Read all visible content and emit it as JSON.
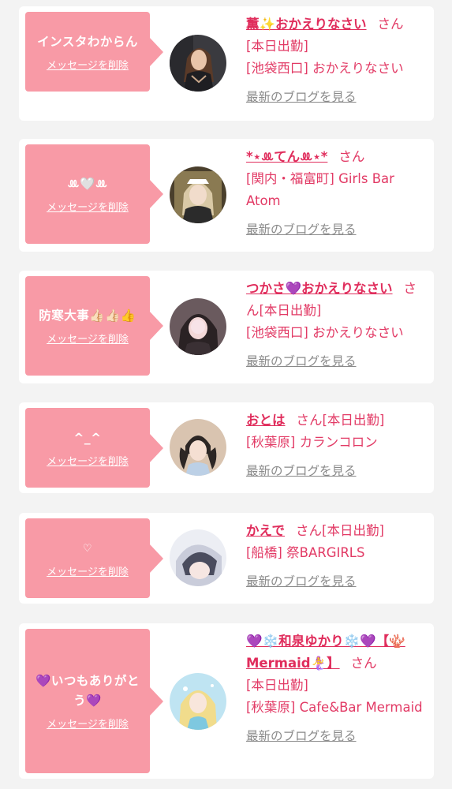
{
  "common": {
    "delete_label": "メッセージを削除",
    "blog_label": "最新のブログを見る",
    "san_label": "さん",
    "colors": {
      "bubble": "#f89aa6",
      "accent": "#e23a65",
      "link_gray": "#8a8a8a"
    }
  },
  "items": [
    {
      "message": "インスタわからん",
      "name": "薫✨おかえりなさい",
      "status": "[本日出勤]",
      "shop": "[池袋西口] おかえりなさい",
      "avatar_icon": "woman-portrait-dark"
    },
    {
      "message": "ꔛ🤍ꔛ",
      "name": "*⋆ꔛてんꔛ⋆*",
      "status": "",
      "shop": "[関内・福富町] Girls Bar Atom",
      "avatar_icon": "woman-portrait-maid"
    },
    {
      "message": "防寒大事👍🏻👍🏻👍",
      "name": "つかさ💜おかえりなさい",
      "status": "[本日出勤]",
      "shop": "[池袋西口] おかえりなさい",
      "avatar_icon": "woman-portrait-blur"
    },
    {
      "message": "^_^",
      "name": "おとは",
      "status": "[本日出勤]",
      "shop": "[秋葉原] カランコロン",
      "avatar_icon": "woman-portrait-twintail"
    },
    {
      "message": "♡",
      "name": "かえで",
      "status": "[本日出勤]",
      "shop": "[船橋] 祭BARGIRLS",
      "avatar_icon": "woman-portrait-silver-hair"
    },
    {
      "message": "💜いつもありがとう💜",
      "name": "💜❄️和泉ゆかり❄️💜【🪸Mermaid🧜‍♀️】",
      "status": "[本日出勤]",
      "shop": "[秋葉原] Cafe&Bar Mermaid",
      "avatar_icon": "woman-portrait-blonde-mermaid"
    }
  ]
}
